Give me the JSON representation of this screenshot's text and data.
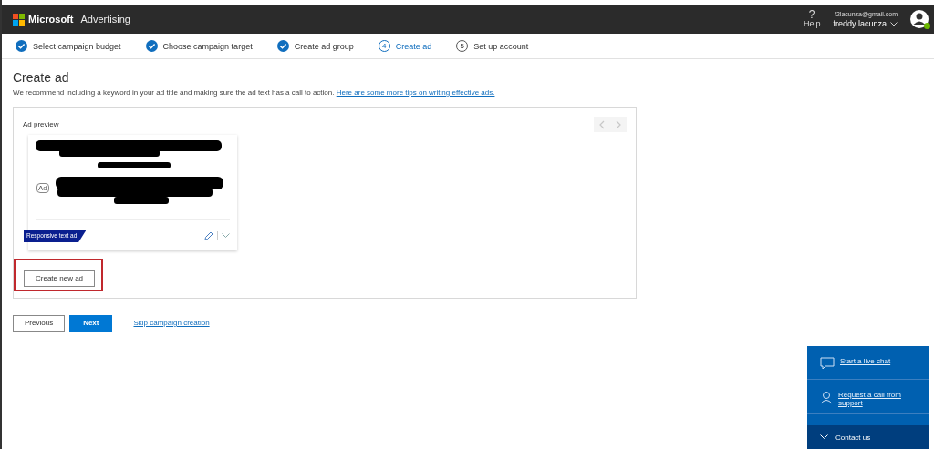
{
  "header": {
    "brand_name": "Microsoft",
    "product": "Advertising",
    "help": {
      "icon": "?",
      "label": "Help"
    },
    "account": {
      "email": "f2lacunza@gmail.com",
      "name": "freddy lacunza",
      "online": true
    }
  },
  "steps": [
    {
      "label": "Select campaign budget",
      "done": true,
      "selected": false
    },
    {
      "label": "Choose campaign target",
      "done": true,
      "selected": false
    },
    {
      "label": "Create ad group",
      "done": true,
      "selected": false
    },
    {
      "number": "4",
      "label": "Create ad",
      "done": false,
      "selected": true
    },
    {
      "number": "5",
      "label": "Set up account",
      "done": false,
      "selected": false
    }
  ],
  "page": {
    "title": "Create ad",
    "intro": "We recommend including a keyword in your ad title and making sure the ad text has a call to action.",
    "intro_link": "Here are some more tips on writing effective ads."
  },
  "preview": {
    "title": "Ad preview",
    "prev_disabled": true,
    "next_disabled": true,
    "ad": {
      "ad_label": "Ad",
      "type_tag": "Responsive text ad"
    },
    "create_button": "Create new ad",
    "create_highlighted": true
  },
  "actions": {
    "previous": "Previous",
    "next": "Next",
    "skip": "Skip campaign creation"
  },
  "contact": {
    "items": [
      {
        "kind": "chat",
        "label": "Start a live chat"
      },
      {
        "kind": "call",
        "label": "Request a call from support"
      }
    ],
    "toggle": "Contact us"
  }
}
